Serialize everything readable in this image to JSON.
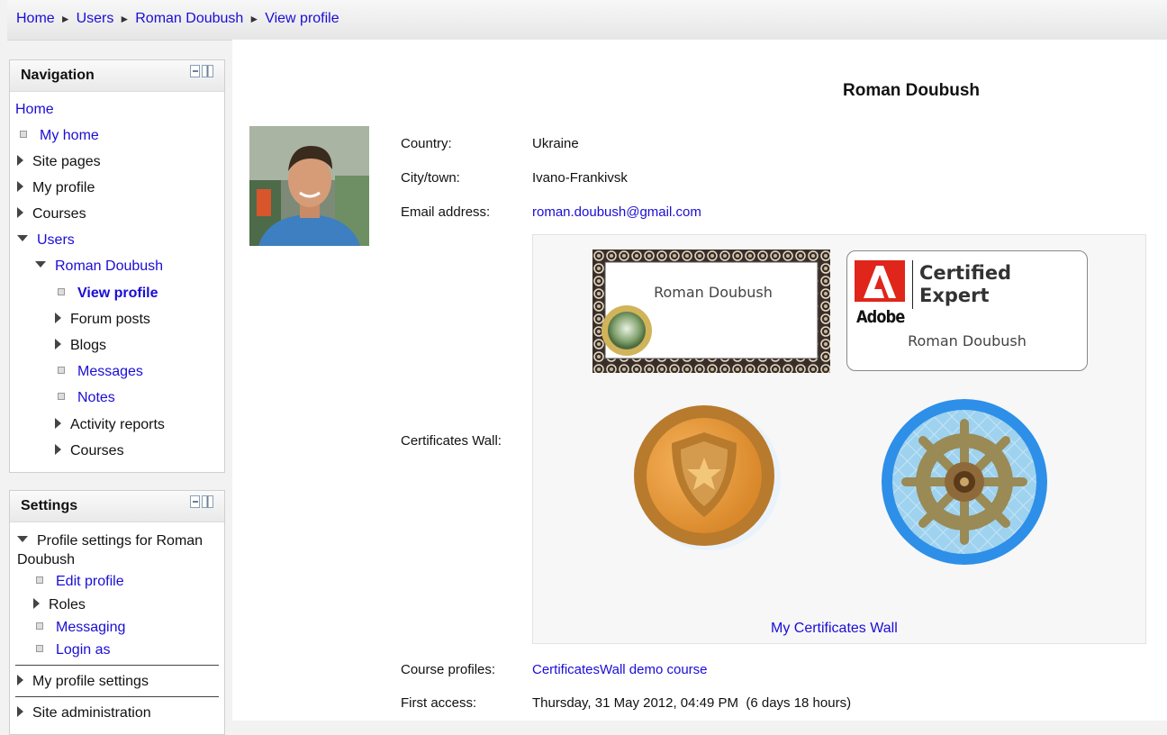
{
  "breadcrumb": [
    "Home",
    "Users",
    "Roman Doubush",
    "View profile"
  ],
  "breadcrumb_separator": "►",
  "navigation": {
    "title": "Navigation",
    "items": [
      {
        "label": "Home",
        "type": "link",
        "depth": 0
      },
      {
        "label": "My home",
        "type": "leaf",
        "depth": 1
      },
      {
        "label": "Site pages",
        "type": "collapsed",
        "depth": 1
      },
      {
        "label": "My profile",
        "type": "collapsed",
        "depth": 1
      },
      {
        "label": "Courses",
        "type": "collapsed",
        "depth": 1
      },
      {
        "label": "Users",
        "type": "expanded",
        "depth": 1
      },
      {
        "label": "Roman Doubush",
        "type": "expanded",
        "depth": 2
      },
      {
        "label": "View profile",
        "type": "active",
        "depth": 3
      },
      {
        "label": "Forum posts",
        "type": "collapsed",
        "depth": 3
      },
      {
        "label": "Blogs",
        "type": "collapsed",
        "depth": 3
      },
      {
        "label": "Messages",
        "type": "leaf",
        "depth": 3
      },
      {
        "label": "Notes",
        "type": "leaf",
        "depth": 3
      },
      {
        "label": "Activity reports",
        "type": "collapsed",
        "depth": 3
      },
      {
        "label": "Courses",
        "type": "collapsed",
        "depth": 3
      }
    ]
  },
  "settings": {
    "title": "Settings",
    "profile_settings": "Profile settings for Roman Doubush",
    "items": [
      "Edit profile",
      "Roles",
      "Messaging",
      "Login as"
    ],
    "my_profile_settings": "My profile settings",
    "site_admin": "Site administration"
  },
  "profile": {
    "name": "Roman Doubush",
    "country_label": "Country:",
    "country": "Ukraine",
    "city_label": "City/town:",
    "city": "Ivano-Frankivsk",
    "email_label": "Email address:",
    "email": "roman.doubush@gmail.com",
    "certs_label": "Certificates Wall:",
    "course_label": "Course profiles:",
    "course": "CertificatesWall demo course",
    "access_label": "First access:",
    "access": "Thursday, 31 May 2012, 04:49 PM  (6 days 18 hours)"
  },
  "certificates": {
    "cert1_name": "Roman Doubush",
    "cert2_brand": "Adobe",
    "cert2_title": "Certified Expert",
    "cert2_title_line1": "Certified",
    "cert2_title_line2": "Expert",
    "cert2_name": "Roman Doubush",
    "wall_link": "My Certificates Wall"
  },
  "colors": {
    "link": "#1a0dd6",
    "adobe_red": "#e0251b",
    "badge_gold": "#c98a2d",
    "badge_blue": "#2f8fe6"
  }
}
